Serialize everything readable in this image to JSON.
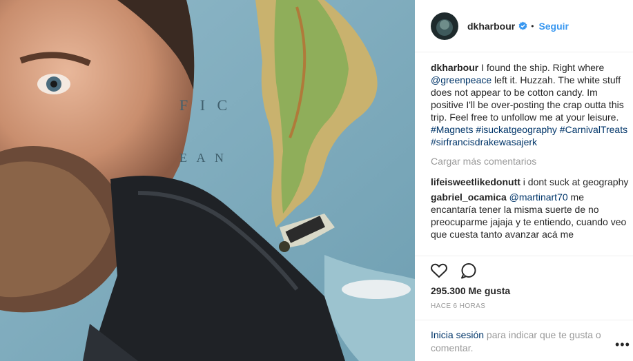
{
  "post": {
    "username": "dkharbour",
    "follow_label": "Seguir",
    "separator": "•"
  },
  "caption": {
    "username": "dkharbour",
    "text_1": " I found the ship. Right where ",
    "mention": "@greenpeace",
    "text_2": " left it. Huzzah. The white stuff does not appear to be cotton candy. Im positive I'll be over-posting the crap outta this trip. Feel free to unfollow me at your leisure. ",
    "hashtags": "#Magnets #isuckatgeography #CarnivalTreats #sirfrancisdrakewasajerk"
  },
  "load_more": "Cargar más comentarios",
  "comments": [
    {
      "username": "lifeisweetlikedonutt",
      "text": " i dont suck at geography"
    },
    {
      "username": "gabriel_ocamica",
      "mention": "@martinart70",
      "text": " me encantaría tener la misma suerte de no preocuparme jajaja y te entiendo, cuando veo que cuesta tanto avanzar acá me"
    }
  ],
  "likes": "295.300 Me gusta",
  "time": "HACE 6 HORAS",
  "login": {
    "link": "Inicia sesión",
    "text": " para indicar que te gusta o comentar."
  },
  "more_label": "•••",
  "icons": {
    "like": "heart-icon",
    "comment": "comment-icon",
    "verified": "verified-badge-icon",
    "more": "more-options-icon"
  },
  "colors": {
    "link_blue": "#3897f0",
    "hashtag": "#003569",
    "muted": "#999999",
    "border": "#efefef"
  }
}
